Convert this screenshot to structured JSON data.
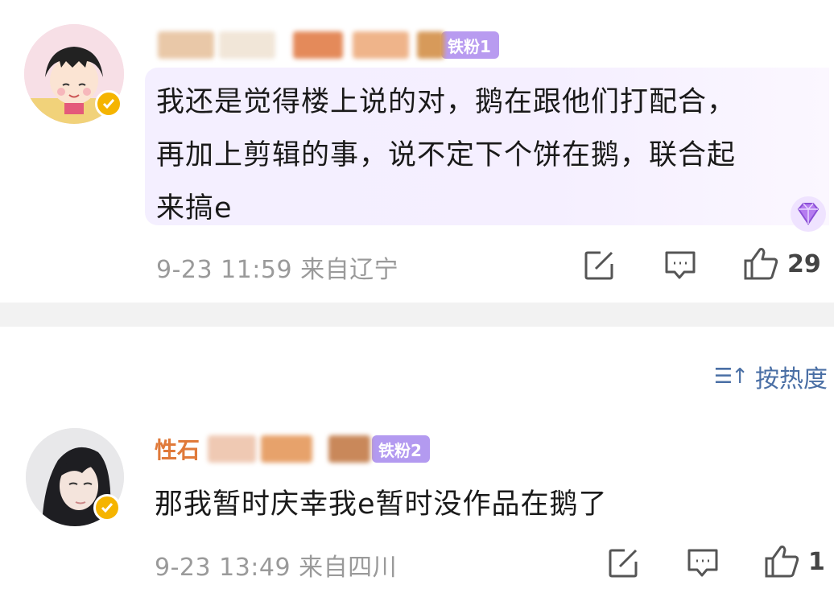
{
  "comments": [
    {
      "badge": "铁粉1",
      "text_lines": [
        "我还是觉得楼上说的对，鹅在跟他们打配合，",
        "再加上剪辑的事，说不定下个饼在鹅，联合起",
        "来搞e"
      ],
      "meta": "9-23 11:59 来自辽宁",
      "likes": "29"
    },
    {
      "name_visible": "性石",
      "badge": "铁粉2",
      "text_lines": [
        "那我暂时庆幸我e暂时没作品在鹅了"
      ],
      "meta": "9-23 13:49 来自四川",
      "likes": "1"
    }
  ],
  "sort": {
    "label": "按热度",
    "icon": "sort-lines-arrow-icon"
  },
  "colors": {
    "accent_blue": "#4a6fa5",
    "badge_purple": "#a88ce8",
    "verify_gold": "#f5b400",
    "meta_gray": "#9a9a9a"
  },
  "icons": [
    "edit-icon",
    "reply-icon",
    "like-icon",
    "diamond-gem-icon",
    "verified-icon"
  ]
}
